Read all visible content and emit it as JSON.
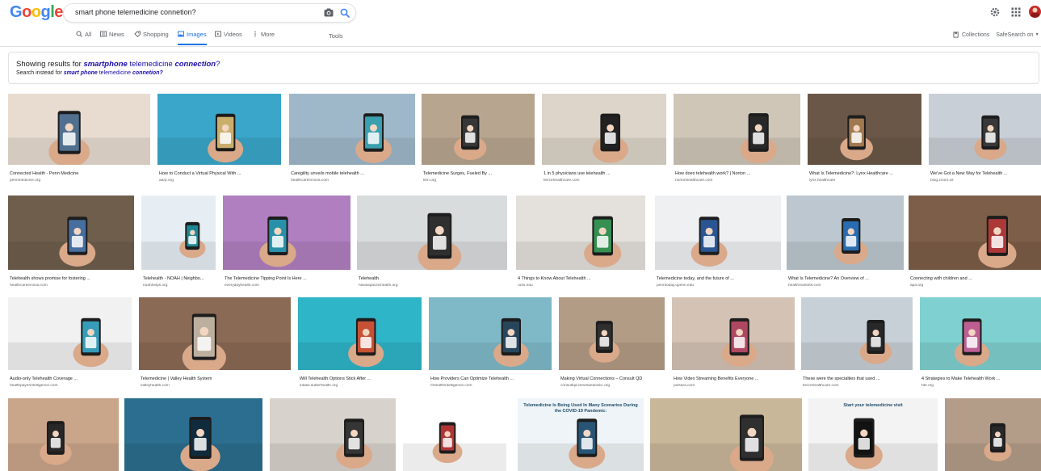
{
  "query": "smart phone telemedicine connetion?",
  "logo_text": "Google",
  "tabs": [
    {
      "label": "All",
      "icon": "search-icon"
    },
    {
      "label": "News",
      "icon": "news-icon"
    },
    {
      "label": "Shopping",
      "icon": "tag-icon"
    },
    {
      "label": "Images",
      "icon": "image-icon"
    },
    {
      "label": "Videos",
      "icon": "play-icon"
    },
    {
      "label": "More",
      "icon": "more-icon"
    }
  ],
  "tools_label": "Tools",
  "collections_label": "Collections",
  "safesearch_label": "SafeSearch on",
  "spelling": {
    "showing_prefix": "Showing results for",
    "showing_query_bold": "smartphone",
    "showing_query_mid": "telemedicine",
    "showing_query_bold2": "connection",
    "search_instead_prefix": "Search instead for",
    "search_instead_bold": "smart phone",
    "search_instead_mid": "telemedicine",
    "search_instead_bold2": "connetion?"
  },
  "rows": [
    [
      {
        "caption": "Connected Health - Penn Medicine",
        "source": "pennmedicine.org",
        "bg": "#e8dcd0",
        "accent": "#5b7fa3"
      },
      {
        "caption": "How to Conduct a Virtual Physical With ...",
        "source": "aarp.org",
        "bg": "#3aa6c9",
        "accent": "#e9c87a"
      },
      {
        "caption": "Caregility unveils mobile telehealth ...",
        "source": "healthcareinnova.com",
        "bg": "#9fb8c9",
        "accent": "#3fb6c8"
      },
      {
        "caption": "Telemedicine Surges, Fueled By ...",
        "source": "khn.org",
        "bg": "#b8a58f",
        "accent": "#3c3c3c"
      },
      {
        "caption": "1 in 5 physicians use telehealth ...",
        "source": "fiercehealthcare.com",
        "bg": "#ddd5c9",
        "accent": "#222"
      },
      {
        "caption": "How does telehealth work? | Norton ...",
        "source": "nortonhealthcare.com",
        "bg": "#cfc6b8",
        "accent": "#2a2a2a"
      },
      {
        "caption": "What Is Telemedicine?: Lynx Healthcare ...",
        "source": "lynx.healthcare",
        "bg": "#6b5747",
        "accent": "#b88a5a"
      },
      {
        "caption": "We've Got a New Way for Telehealth ...",
        "source": "blog.zoom.us",
        "bg": "#c9cfd6",
        "accent": "#3d3d3d"
      }
    ],
    [
      {
        "caption": "Telehealth shows promise for fostering ...",
        "source": "healthcareinnova.com",
        "bg": "#6f5e4c",
        "accent": "#4d7cb5"
      },
      {
        "caption": "Telehealth - NOAH | Neighbo...",
        "source": "noahhelps.org",
        "bg": "#e7eef3",
        "accent": "#1f9aa8"
      },
      {
        "caption": "The Telemedicine Tipping Point Is Here ...",
        "source": "everydayhealth.com",
        "bg": "#b07fc0",
        "accent": "#2aa6c2"
      },
      {
        "caption": "Telehealth",
        "source": "hawaiipacifichealth.org",
        "bg": "#d9dcdd",
        "accent": "#333"
      },
      {
        "caption": "4 Things to Know About Telehealth ...",
        "source": "rush.edu",
        "bg": "#e4e0dc",
        "accent": "#3aa55c"
      },
      {
        "caption": "Telemedicine today, and the future of ...",
        "source": "penntoday.upenn.edu",
        "bg": "#eef0f2",
        "accent": "#2c5fa8"
      },
      {
        "caption": "What Is Telemedicine? An Overview of ...",
        "source": "healthmarkets.com",
        "bg": "#bcc7cf",
        "accent": "#2b7ac9"
      },
      {
        "caption": "Connecting with children and ...",
        "source": "apa.org",
        "bg": "#7d5e48",
        "accent": "#c73d3d"
      }
    ],
    [
      {
        "caption": "Audio-only Telehealth Coverage ...",
        "source": "healthpayerintelligence.com",
        "bg": "#f1f1f1",
        "accent": "#3cb3d4"
      },
      {
        "caption": "Telemedicine | Valley Health System",
        "source": "valleyhealth.com",
        "bg": "#8a6a55",
        "accent": "#d8c9b5"
      },
      {
        "caption": "Will Telehealth Options Stick After ...",
        "source": "intalio.sutterhealth.org",
        "bg": "#2fb5c8",
        "accent": "#e45a3a"
      },
      {
        "caption": "How Providers Can Optimize Telehealth ...",
        "source": "mhealthintelligence.com",
        "bg": "#7fb9c8",
        "accent": "#2a4e66"
      },
      {
        "caption": "Making Virtual Connections – Consult QD",
        "source": "consultqd.clevelandclinic.org",
        "bg": "#b39c86",
        "accent": "#333"
      },
      {
        "caption": "How Video Streaming Benefits Everyone ...",
        "source": "pulsara.com",
        "bg": "#d4c3b5",
        "accent": "#c94f6d"
      },
      {
        "caption": "These were the specialties that used ...",
        "source": "fiercehealthcare.com",
        "bg": "#c7d0d6",
        "accent": "#2a2a2a"
      },
      {
        "caption": "4 Strategies to Make Telehealth Work ...",
        "source": "hbr.org",
        "bg": "#7fd0d0",
        "accent": "#d96ba8"
      }
    ],
    [
      {
        "caption": "",
        "source": "",
        "bg": "#c9a58a",
        "accent": "#2a2a2a"
      },
      {
        "caption": "",
        "source": "",
        "bg": "#2c6e8f",
        "accent": "#0f2e44"
      },
      {
        "caption": "",
        "source": "",
        "bg": "#d8d2cc",
        "accent": "#3a3a3a"
      },
      {
        "caption": "",
        "source": "",
        "bg": "#ffffff",
        "accent": "#c93a3a"
      },
      {
        "caption": "Telemedicine Is Being Used In Many Scenarios During the COVID-19 Pandemic:",
        "source": "",
        "bg": "#eef4f7",
        "accent": "#2a5f86"
      },
      {
        "caption": "",
        "source": "",
        "bg": "#c9b79a",
        "accent": "#333"
      },
      {
        "caption": "Start your telemedicine visit",
        "source": "",
        "bg": "#f3f3f3",
        "accent": "#111"
      },
      {
        "caption": "",
        "source": "",
        "bg": "#b39c88",
        "accent": "#2a2a2a"
      }
    ]
  ]
}
